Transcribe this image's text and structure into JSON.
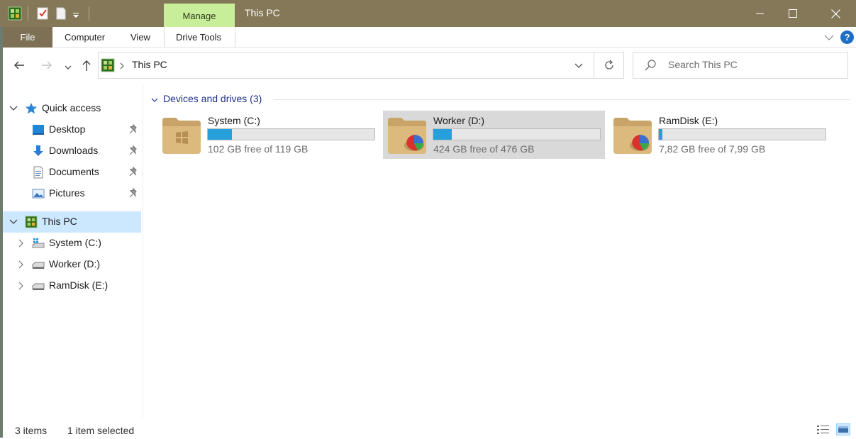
{
  "window": {
    "title": "This PC",
    "contextual_tab": "Manage",
    "contextual_group": "Drive Tools"
  },
  "ribbon": {
    "tabs": [
      "File",
      "Computer",
      "View",
      "Drive Tools"
    ],
    "help_glyph": "?"
  },
  "address": {
    "current": "This PC",
    "search_placeholder": "Search This PC"
  },
  "nav": {
    "quick_access": "Quick access",
    "pinned": [
      {
        "label": "Desktop",
        "icon": "desktop-icon"
      },
      {
        "label": "Downloads",
        "icon": "downloads-icon"
      },
      {
        "label": "Documents",
        "icon": "documents-icon"
      },
      {
        "label": "Pictures",
        "icon": "pictures-icon"
      }
    ],
    "this_pc": "This PC",
    "drives": [
      {
        "label": "System (C:)"
      },
      {
        "label": "Worker (D:)"
      },
      {
        "label": "RamDisk (E:)"
      }
    ]
  },
  "content": {
    "group_header": "Devices and drives (3)",
    "drives": [
      {
        "name": "System (C:)",
        "free_text": "102 GB free of 119 GB",
        "used_fraction": 0.143,
        "selected": false
      },
      {
        "name": "Worker (D:)",
        "free_text": "424 GB free of 476 GB",
        "used_fraction": 0.109,
        "selected": true
      },
      {
        "name": "RamDisk (E:)",
        "free_text": "7,82 GB free of 7,99 GB",
        "used_fraction": 0.021,
        "selected": false
      }
    ]
  },
  "status": {
    "items": "3 items",
    "selected": "1 item selected"
  },
  "colors": {
    "titlebar": "#857858",
    "manage_tab": "#c9ee99",
    "selection": "#cce8ff",
    "bar_fill": "#26a0da",
    "link_blue": "#1e3287"
  }
}
